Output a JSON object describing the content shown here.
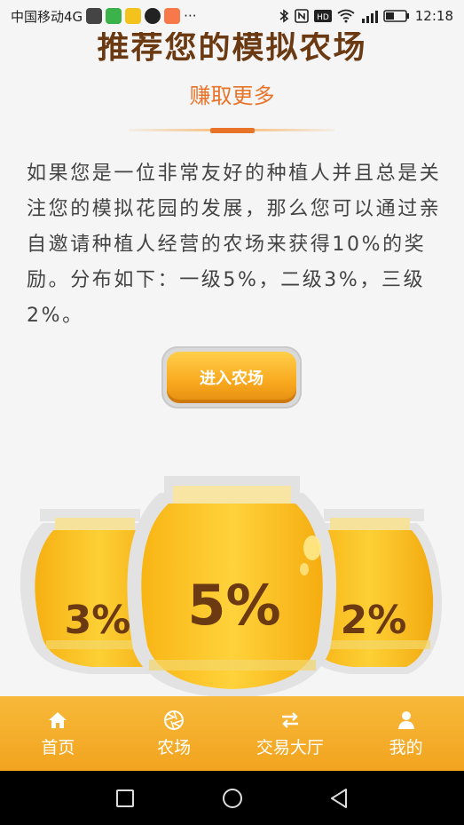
{
  "status_bar": {
    "carrier": "中国移动4G",
    "more": "···",
    "time": "12:18",
    "icons": [
      "bluetooth-icon",
      "nfc-icon",
      "hd-icon",
      "wifi-icon",
      "signal-icon",
      "battery-icon"
    ]
  },
  "page": {
    "title": "推荐您的模拟农场",
    "subtitle": "赚取更多",
    "description": "如果您是一位非常友好的种植人并且总是关注您的模拟花园的发展，那么您可以通过亲自邀请种植人经营的农场来获得10%的奖励。分布如下：一级5%，二级3%，三级2%。",
    "enter_button": "进入农场"
  },
  "jars": {
    "left": "3%",
    "center": "5%",
    "right": "2%"
  },
  "bottom_nav": {
    "items": [
      {
        "label": "首页",
        "icon": "home-icon"
      },
      {
        "label": "农场",
        "icon": "aperture-icon"
      },
      {
        "label": "交易大厅",
        "icon": "swap-icon"
      },
      {
        "label": "我的",
        "icon": "user-icon"
      }
    ]
  },
  "colors": {
    "accent": "#f2a41f",
    "title_brown": "#6b3a12",
    "subtitle_orange": "#e8742a",
    "jar_gold": "#fbbf1c"
  }
}
